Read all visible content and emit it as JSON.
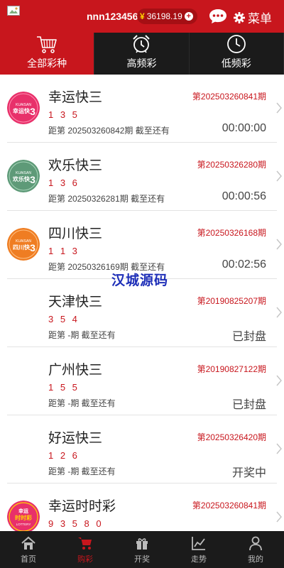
{
  "header": {
    "username": "nnn123456",
    "currency_symbol": "¥",
    "balance": "36198.19",
    "add_symbol": "+",
    "menu_label": "菜单",
    "colors": {
      "brand": "#c8161d",
      "dark": "#1b1b1b"
    }
  },
  "tabs": [
    {
      "label": "全部彩种",
      "icon": "cart-icon",
      "active": true
    },
    {
      "label": "高频彩",
      "icon": "alarm-clock-icon",
      "active": false
    },
    {
      "label": "低频彩",
      "icon": "clock-icon",
      "active": false
    }
  ],
  "lotteries": [
    {
      "name": "幸运快三",
      "period": "第202503260841期",
      "numbers": "1 3 5",
      "next": "距第 202503260842期 截至还有",
      "status": "00:00:00",
      "badge": "幸运快3"
    },
    {
      "name": "欢乐快三",
      "period": "第20250326280期",
      "numbers": "1 3 6",
      "next": "距第 20250326281期 截至还有",
      "status": "00:00:56",
      "badge": "欢乐快3"
    },
    {
      "name": "四川快三",
      "period": "第20250326168期",
      "numbers": "1 1 3",
      "next": "距第 20250326169期 截至还有",
      "status": "00:02:56",
      "badge": "四川快3"
    },
    {
      "name": "天津快三",
      "period": "第20190825207期",
      "numbers": "3 5 4",
      "next": "距第 -期 截至还有",
      "status": "已封盘",
      "badge": ""
    },
    {
      "name": "广州快三",
      "period": "第20190827122期",
      "numbers": "1 5 5",
      "next": "距第 -期 截至还有",
      "status": "已封盘",
      "badge": ""
    },
    {
      "name": "好运快三",
      "period": "第20250326420期",
      "numbers": "1 2 6",
      "next": "距第 -期 截至还有",
      "status": "开奖中",
      "badge": ""
    },
    {
      "name": "幸运时时彩",
      "period": "第202503260841期",
      "numbers": "9 3 5 8 0",
      "next": "",
      "status": "",
      "badge": "幸运时时彩"
    }
  ],
  "watermark": "汉城源码",
  "bottom_nav": [
    {
      "label": "首页",
      "icon": "home-icon",
      "active": false
    },
    {
      "label": "购彩",
      "icon": "cart-icon",
      "active": true
    },
    {
      "label": "开奖",
      "icon": "gift-icon",
      "active": false
    },
    {
      "label": "走势",
      "icon": "trend-chart-icon",
      "active": false
    },
    {
      "label": "我的",
      "icon": "user-icon",
      "active": false
    }
  ]
}
